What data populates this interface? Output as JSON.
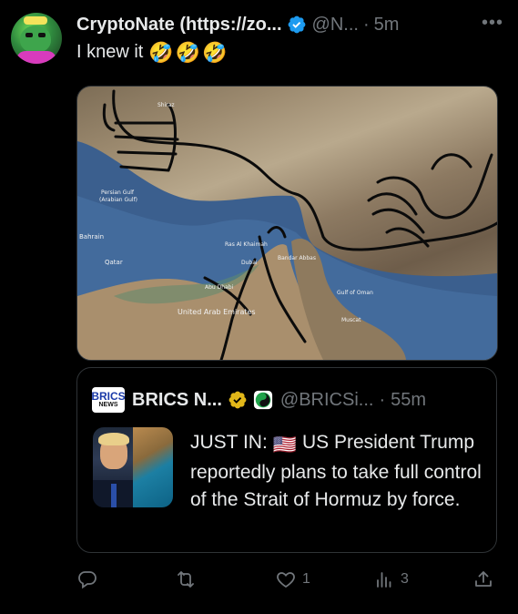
{
  "tweet": {
    "display_name": "CryptoNate (https://zo...",
    "handle": "@N...",
    "separator": "·",
    "time": "5m",
    "more": "•••",
    "text": "I knew it",
    "emojis": [
      "🤣",
      "🤣",
      "🤣"
    ]
  },
  "map": {
    "labels": {
      "shiraz": "Shiraz",
      "persian_gulf": "Persian Gulf",
      "arabian_gulf": "(Arabian Gulf)",
      "bahrain": "Bahrain",
      "qatar": "Qatar",
      "ras_al_khaimah": "Ras Al Khaimah",
      "dubai": "Dubai",
      "abu_dhabi": "Abu Dhabi",
      "uae": "United Arab\nEmirates",
      "gulf_of_oman": "Gulf of Oman",
      "muscat": "Muscat",
      "bandar_abbas": "Bandar Abbas"
    }
  },
  "quote": {
    "logo_top": "BRICS",
    "logo_bottom": "NEWS",
    "display_name": "BRICS N...",
    "handle": "@BRICSi...",
    "separator": "·",
    "time": "55m",
    "text_prefix": "JUST IN:",
    "flag_emoji": "🇺🇸",
    "text_body": "US President Trump reportedly plans to take full control of the Strait of Hormuz by force."
  },
  "actions": {
    "reply_count": "",
    "retweet_count": "",
    "like_count": "1",
    "views_count": "3"
  },
  "colors": {
    "background": "#000000",
    "text": "#e7e9ea",
    "muted": "#71767b",
    "verified_blue": "#1d9bf0",
    "gold_badge": "#e2b719",
    "border": "#2f3336"
  }
}
